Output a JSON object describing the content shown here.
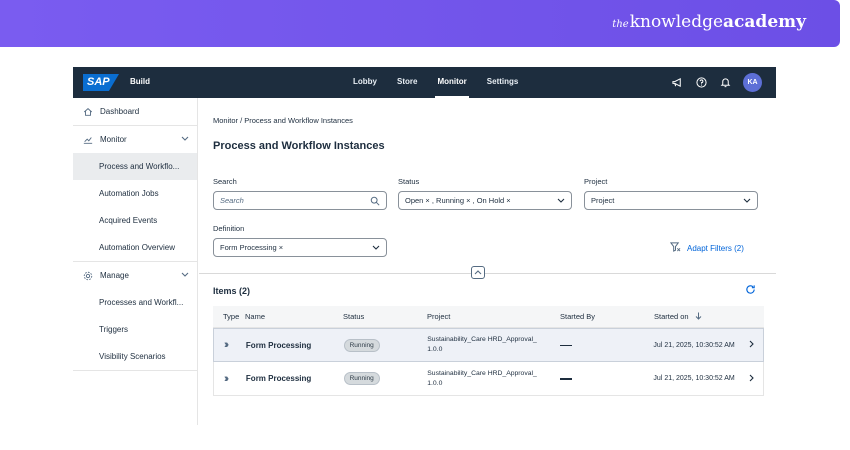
{
  "banner": {
    "brand_the": "the",
    "brand_knowledge": "knowledge",
    "brand_academy": "academy"
  },
  "shell": {
    "logo": "SAP",
    "product": "Build",
    "nav": [
      "Lobby",
      "Store",
      "Monitor",
      "Settings"
    ],
    "active_nav": "Monitor",
    "avatar": "KA"
  },
  "sidebar": {
    "items": [
      {
        "label": "Dashboard",
        "icon": "home-icon"
      },
      {
        "label": "Monitor",
        "icon": "monitor-icon"
      },
      {
        "label": "Process and Workflo..."
      },
      {
        "label": "Automation Jobs"
      },
      {
        "label": "Acquired Events"
      },
      {
        "label": "Automation Overview"
      },
      {
        "label": "Manage",
        "icon": "gear-icon"
      },
      {
        "label": "Processes and Workfl..."
      },
      {
        "label": "Triggers"
      },
      {
        "label": "Visibility Scenarios"
      }
    ]
  },
  "main": {
    "breadcrumb": "Monitor / Process and Workflow Instances",
    "title": "Process and Workflow Instances",
    "filters": {
      "search_label": "Search",
      "search_placeholder": "Search",
      "status_label": "Status",
      "status_value": "Open × , Running × , On Hold ×",
      "project_label": "Project",
      "project_value": "Project",
      "definition_label": "Definition",
      "definition_value": "Form Processing ×",
      "adapt_filters": "Adapt Filters (2)"
    },
    "items_title": "Items (2)",
    "table": {
      "headers": [
        "Type",
        "Name",
        "Status",
        "Project",
        "Started By",
        "Started on"
      ],
      "rows": [
        {
          "name": "Form Processing",
          "status": "Running",
          "project_line1": "Sustainability_Care HRD_Approval_",
          "project_line2": "1.0.0",
          "started_on": "Jul 21, 2025, 10:30:52 AM"
        },
        {
          "name": "Form Processing",
          "status": "Running",
          "project_line1": "Sustainability_Care HRD_Approval_",
          "project_line2": "1.0.0",
          "started_on": "Jul 21, 2025, 10:30:52 AM"
        }
      ]
    }
  }
}
